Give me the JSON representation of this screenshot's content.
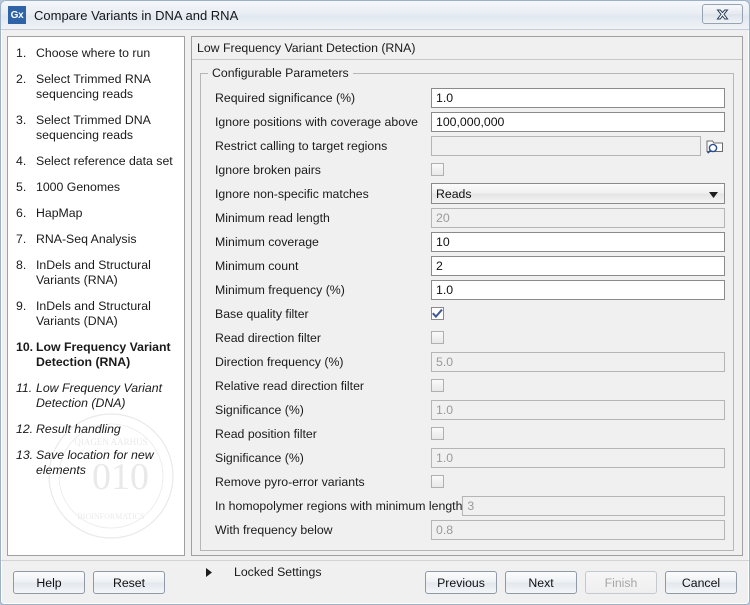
{
  "window": {
    "title": "Compare Variants in DNA and RNA",
    "app_icon_label": "Gx",
    "close_label": "X"
  },
  "sidebar": {
    "steps": [
      {
        "num": "1.",
        "label": "Choose where to run",
        "state": "done"
      },
      {
        "num": "2.",
        "label": "Select Trimmed RNA sequencing reads",
        "state": "done"
      },
      {
        "num": "3.",
        "label": "Select Trimmed DNA sequencing reads",
        "state": "done"
      },
      {
        "num": "4.",
        "label": "Select reference data set",
        "state": "done"
      },
      {
        "num": "5.",
        "label": "1000 Genomes",
        "state": "done"
      },
      {
        "num": "6.",
        "label": "HapMap",
        "state": "done"
      },
      {
        "num": "7.",
        "label": "RNA-Seq Analysis",
        "state": "done"
      },
      {
        "num": "8.",
        "label": "InDels and Structural Variants (RNA)",
        "state": "done"
      },
      {
        "num": "9.",
        "label": "InDels and Structural Variants (DNA)",
        "state": "done"
      },
      {
        "num": "10.",
        "label": "Low Frequency Variant Detection (RNA)",
        "state": "current"
      },
      {
        "num": "11.",
        "label": "Low Frequency Variant Detection (DNA)",
        "state": "future"
      },
      {
        "num": "12.",
        "label": "Result handling",
        "state": "future"
      },
      {
        "num": "13.",
        "label": "Save location for new elements",
        "state": "future"
      }
    ]
  },
  "main": {
    "header": "Low Frequency Variant Detection (RNA)",
    "group_legend": "Configurable Parameters",
    "locked_settings_label": "Locked Settings",
    "parameters": [
      {
        "label": "Required significance (%)",
        "type": "text",
        "value": "1.0",
        "disabled": false
      },
      {
        "label": "Ignore positions with coverage above",
        "type": "text",
        "value": "100,000,000",
        "disabled": false
      },
      {
        "label": "Restrict calling to target regions",
        "type": "browse",
        "value": "",
        "disabled": true
      },
      {
        "label": "Ignore broken pairs",
        "type": "checkbox",
        "checked": false,
        "disabled": true
      },
      {
        "label": "Ignore non-specific matches",
        "type": "combo",
        "value": "Reads",
        "disabled": false
      },
      {
        "label": "Minimum read length",
        "type": "text",
        "value": "20",
        "disabled": true
      },
      {
        "label": "Minimum coverage",
        "type": "text",
        "value": "10",
        "disabled": false
      },
      {
        "label": "Minimum count",
        "type": "text",
        "value": "2",
        "disabled": false
      },
      {
        "label": "Minimum frequency (%)",
        "type": "text",
        "value": "1.0",
        "disabled": false
      },
      {
        "label": "Base quality filter",
        "type": "checkbox",
        "checked": true,
        "disabled": false
      },
      {
        "label": "Read direction filter",
        "type": "checkbox",
        "checked": false,
        "disabled": true
      },
      {
        "label": "Direction frequency (%)",
        "type": "text",
        "value": "5.0",
        "disabled": true
      },
      {
        "label": "Relative read direction filter",
        "type": "checkbox",
        "checked": false,
        "disabled": true
      },
      {
        "label": "Significance (%)",
        "type": "text",
        "value": "1.0",
        "disabled": true
      },
      {
        "label": "Read position filter",
        "type": "checkbox",
        "checked": false,
        "disabled": true
      },
      {
        "label": "Significance (%)",
        "type": "text",
        "value": "1.0",
        "disabled": true
      },
      {
        "label": "Remove pyro-error variants",
        "type": "checkbox",
        "checked": false,
        "disabled": true
      },
      {
        "label": "In homopolymer regions with minimum length",
        "type": "text",
        "value": "3",
        "disabled": true
      },
      {
        "label": "With frequency below",
        "type": "text",
        "value": "0.8",
        "disabled": true
      }
    ]
  },
  "footer": {
    "help": "Help",
    "reset": "Reset",
    "previous": "Previous",
    "next": "Next",
    "finish": "Finish",
    "cancel": "Cancel"
  },
  "colors": {
    "accent": "#2e63a8",
    "check": "#3b5998",
    "window_bg": "#f0f0f0"
  }
}
